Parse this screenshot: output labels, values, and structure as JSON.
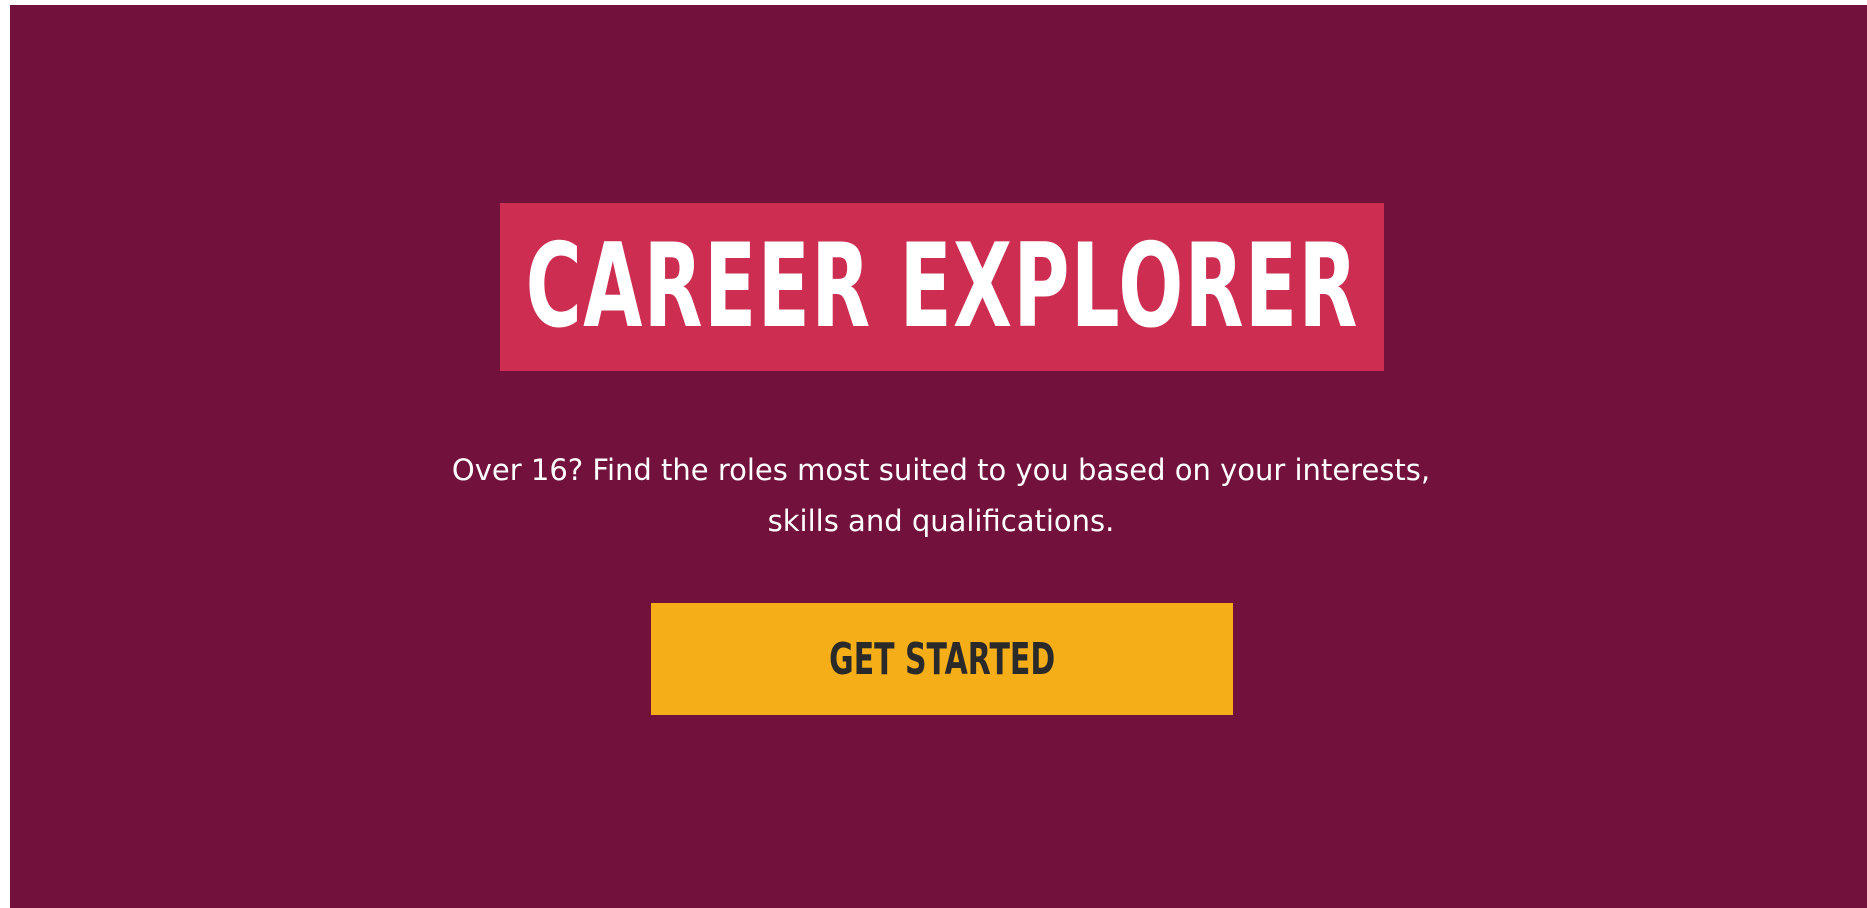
{
  "hero": {
    "title": "CAREER EXPLORER",
    "subtitle": "Over 16? Find the roles most suited to you based on your interests, skills and qualifications.",
    "cta_label": "GET STARTED"
  },
  "colors": {
    "background": "#71113c",
    "title_box": "#cc2d50",
    "cta_button": "#f5ae17",
    "cta_text": "#2a2a2a",
    "text": "#ffffff"
  }
}
